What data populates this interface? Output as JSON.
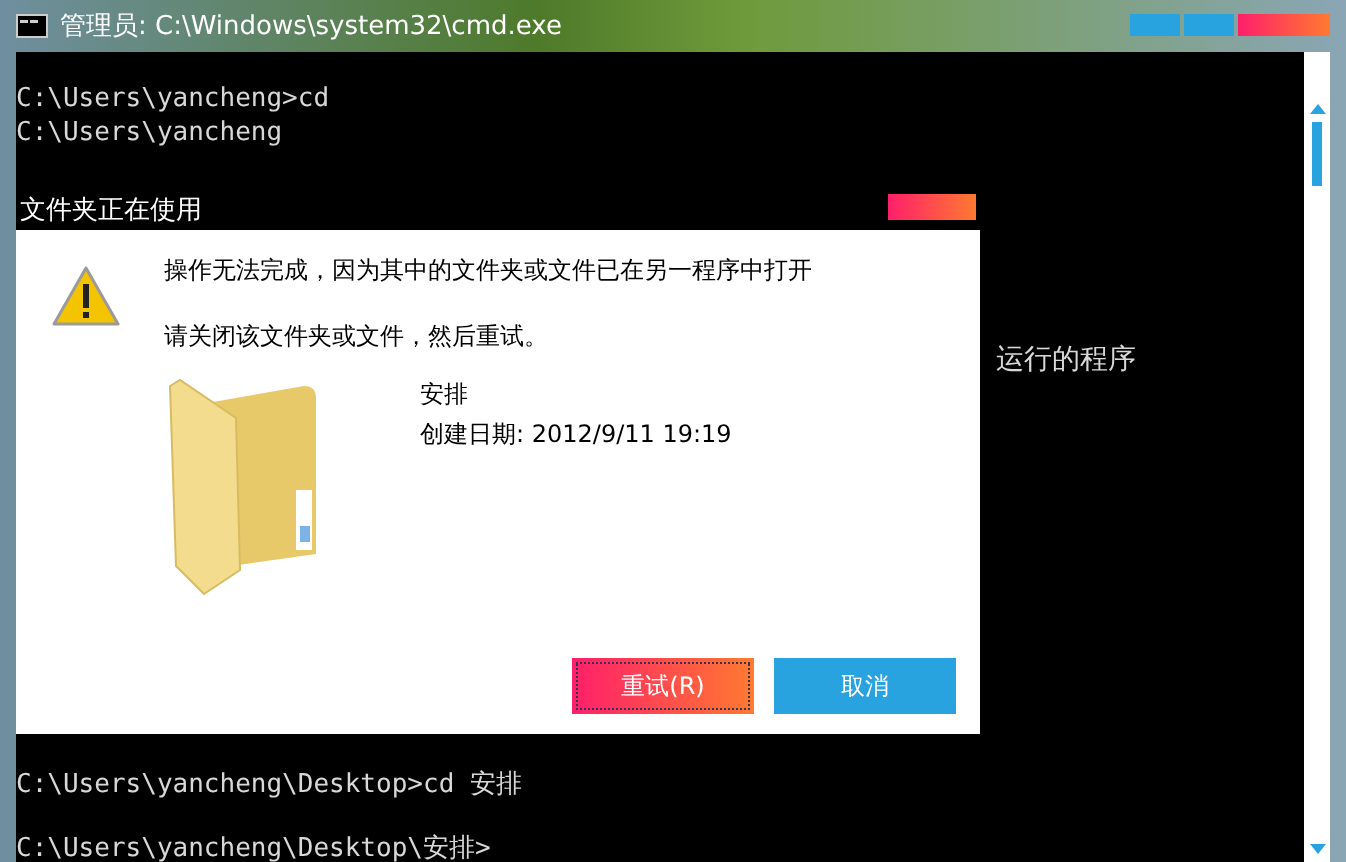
{
  "window": {
    "title": "管理员: C:\\Windows\\system32\\cmd.exe"
  },
  "console": {
    "lines_top": [
      "C:\\Users\\yancheng>cd",
      "C:\\Users\\yancheng"
    ],
    "side_text": "运行的程序",
    "lines_bottom": [
      "C:\\Users\\yancheng\\Desktop>cd 安排",
      "C:\\Users\\yancheng\\Desktop\\安排>"
    ]
  },
  "dialog": {
    "title": "文件夹正在使用",
    "message": "操作无法完成，因为其中的文件夹或文件已在另一程序中打开",
    "hint": "请关闭该文件夹或文件，然后重试。",
    "item_name": "安排",
    "item_date": "创建日期: 2012/9/11 19:19",
    "buttons": [
      {
        "label": "重试(R)",
        "focused": true
      },
      {
        "label": "取消",
        "focused": false
      }
    ]
  }
}
